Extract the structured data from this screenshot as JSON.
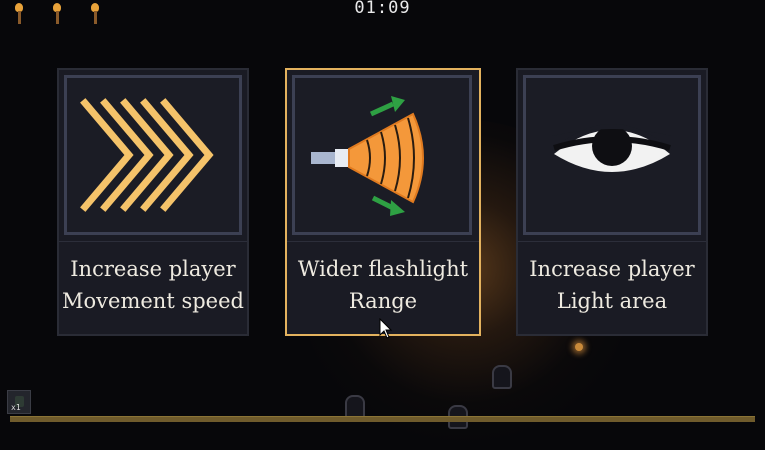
{
  "hud": {
    "timer": "01:09",
    "torches": [
      "torch-icon",
      "torch-icon",
      "torch-icon"
    ],
    "item_count": "x1"
  },
  "upgrade_cards": [
    {
      "icon": "chevrons-icon",
      "line1": "Increase player",
      "line2": "Movement speed",
      "selected": false
    },
    {
      "icon": "flashlight-icon",
      "line1": "Wider flashlight",
      "line2": "Range",
      "selected": true
    },
    {
      "icon": "eye-icon",
      "line1": "Increase player",
      "line2": "Light area",
      "selected": false
    }
  ],
  "colors": {
    "accent": "#e3b25e",
    "card_bg": "#1a1b24",
    "icon_orange": "#f4983a",
    "chevron_yellow": "#f5c36a",
    "arrow_green": "#2ea043",
    "text": "#eeeae0"
  }
}
